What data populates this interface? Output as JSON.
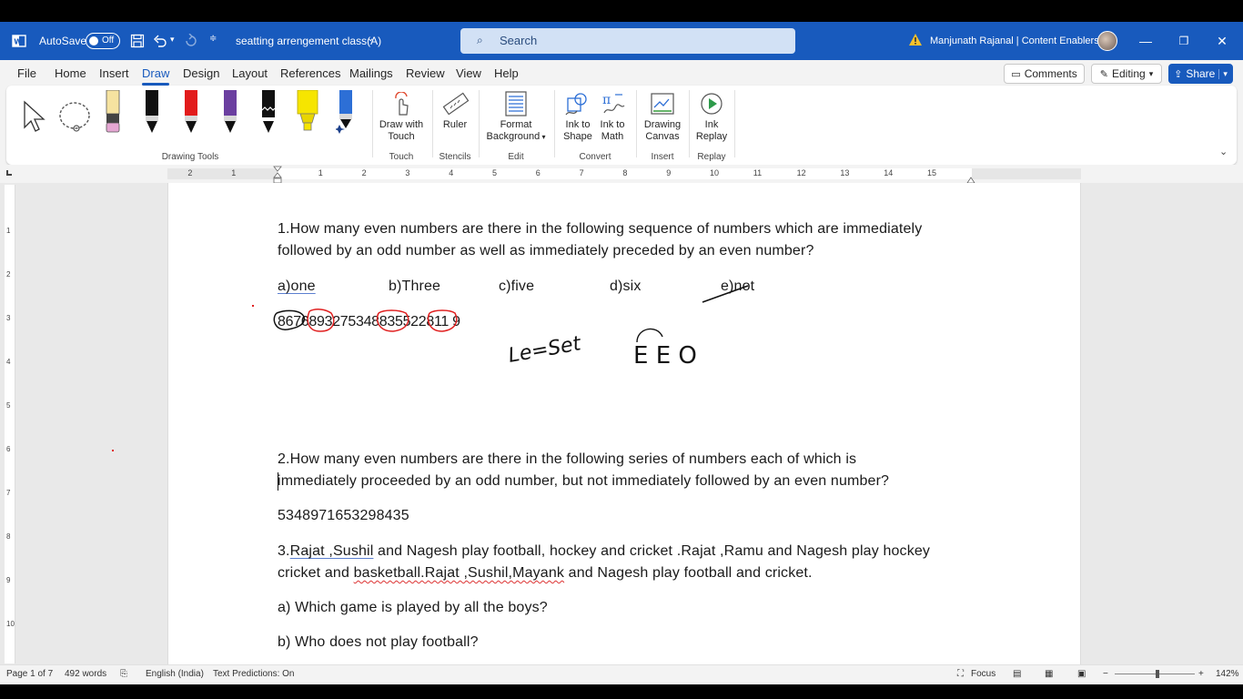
{
  "titlebar": {
    "autosave_label": "AutoSave",
    "autosave_state": "Off",
    "doc_title": "seatting arrengement class(A)",
    "search_placeholder": "Search",
    "user_name": "Manjunath Rajanal | Content Enablers",
    "accent_color": "#185abd"
  },
  "menu": {
    "tabs": [
      "File",
      "Home",
      "Insert",
      "Draw",
      "Design",
      "Layout",
      "References",
      "Mailings",
      "Review",
      "View",
      "Help"
    ],
    "active_tab": "Draw",
    "comments_label": "Comments",
    "editing_label": "Editing",
    "share_label": "Share"
  },
  "ribbon": {
    "groups": {
      "drawing_tools": "Drawing Tools",
      "touch": "Touch",
      "stencils": "Stencils",
      "edit": "Edit",
      "convert": "Convert",
      "insert": "Insert",
      "replay": "Replay"
    },
    "buttons": {
      "draw_with_touch_1": "Draw with",
      "draw_with_touch_2": "Touch",
      "ruler": "Ruler",
      "format_background_1": "Format",
      "format_background_2": "Background",
      "ink_to_shape_1": "Ink to",
      "ink_to_shape_2": "Shape",
      "ink_to_math_1": "Ink to",
      "ink_to_math_2": "Math",
      "drawing_canvas_1": "Drawing",
      "drawing_canvas_2": "Canvas",
      "ink_replay_1": "Ink",
      "ink_replay_2": "Replay"
    },
    "pens": [
      "pencil-yellow",
      "pen-black",
      "pen-red",
      "pen-purple",
      "pen-black-textured",
      "highlighter-yellow",
      "action-pen-blue"
    ]
  },
  "ruler": {
    "numbers": [
      "2",
      "1",
      "1",
      "2",
      "3",
      "4",
      "5",
      "6",
      "7",
      "8",
      "9",
      "10",
      "11",
      "12",
      "13",
      "14",
      "15"
    ]
  },
  "document": {
    "q1_line1": "1.How many even numbers are there in the following sequence of numbers which are immediately",
    "q1_line2": "followed by an odd number as well as immediately preceded by an even number?",
    "q1_options": [
      "a)one",
      "b)Three",
      "c)five",
      "d)six",
      "e)not"
    ],
    "q1_sequence": "8676893275348835522811 9",
    "ink_notes": [
      "Le=Set",
      "E E O"
    ],
    "q2_line1": "2.How many even numbers are there in the following series of numbers each of which is",
    "q2_line2": "immediately proceeded by an odd number, but not immediately followed by an even number?",
    "q2_sequence": "5348971653298435",
    "q3_line1_a": "3.",
    "q3_line1_b": "Rajat ,Sushil",
    "q3_line1_c": " and Nagesh play football, hockey and cricket .Rajat ,Ramu and Nagesh play hockey",
    "q3_line2_a": "cricket and ",
    "q3_line2_b": "basketball.Rajat ,Sushil,Mayank",
    "q3_line2_c": " and Nagesh play football and cricket.",
    "qa": "a) Which game is played by all the boys?",
    "qb": "b) Who does not play football?"
  },
  "statusbar": {
    "page": "Page 1 of 7",
    "words": "492 words",
    "language": "English (India)",
    "text_predictions": "Text Predictions: On",
    "focus": "Focus",
    "zoom": "142%"
  }
}
